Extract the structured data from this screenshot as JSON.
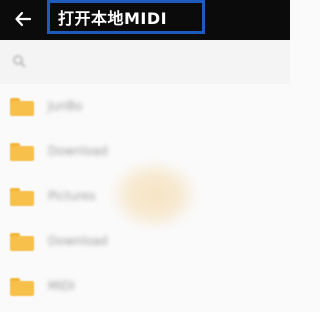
{
  "header": {
    "title": "打开本地MIDI",
    "back_icon": "arrow-left-icon"
  },
  "colors": {
    "appbar": "#0b0b0b",
    "title_highlight": "#1f5bbd",
    "folder": "#f7c04a",
    "background": "#fafafa"
  },
  "path": {
    "icon": "folder-up-icon"
  },
  "folders": [
    {
      "label": "JunBo",
      "icon": "folder-icon"
    },
    {
      "label": "Download",
      "icon": "folder-icon"
    },
    {
      "label": "Pictures",
      "icon": "folder-icon"
    },
    {
      "label": "Download",
      "icon": "folder-icon"
    },
    {
      "label": "MIDI",
      "icon": "folder-icon"
    }
  ]
}
